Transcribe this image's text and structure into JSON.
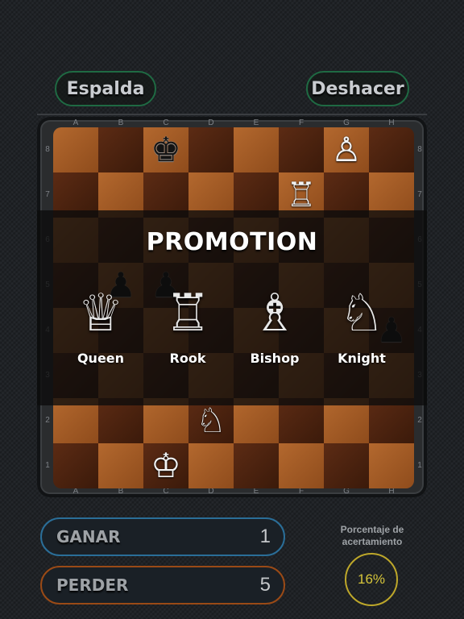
{
  "buttons": {
    "back": "Espalda",
    "undo": "Deshacer"
  },
  "board": {
    "files": [
      "A",
      "B",
      "C",
      "D",
      "E",
      "F",
      "G",
      "H"
    ],
    "ranks": [
      "8",
      "7",
      "6",
      "5",
      "4",
      "3",
      "2",
      "1"
    ],
    "pieces": [
      {
        "square": "c8",
        "piece": "king",
        "color": "black",
        "glyph": "♚"
      },
      {
        "square": "g8",
        "piece": "pawn",
        "color": "white",
        "glyph": "♙"
      },
      {
        "square": "f7",
        "piece": "rook",
        "color": "white",
        "glyph": "♖"
      },
      {
        "square": "b5",
        "piece": "pawn",
        "color": "black",
        "glyph": "♟"
      },
      {
        "square": "c5",
        "piece": "pawn",
        "color": "black",
        "glyph": "♟"
      },
      {
        "square": "h4",
        "piece": "pawn",
        "color": "black",
        "glyph": "♟"
      },
      {
        "square": "d2",
        "piece": "knight",
        "color": "white",
        "glyph": "♘"
      },
      {
        "square": "c1",
        "piece": "king",
        "color": "white",
        "glyph": "♔"
      }
    ]
  },
  "promotion": {
    "title": "PROMOTION",
    "options": [
      {
        "label": "Queen",
        "icon": "queen-icon",
        "glyph": "♕"
      },
      {
        "label": "Rook",
        "icon": "rook-icon",
        "glyph": "♖"
      },
      {
        "label": "Bishop",
        "icon": "bishop-icon",
        "glyph": "♗"
      },
      {
        "label": "Knight",
        "icon": "knight-icon",
        "glyph": "♘"
      }
    ]
  },
  "stats": {
    "win": {
      "label": "GANAR",
      "value": "1"
    },
    "lose": {
      "label": "PERDER",
      "value": "5"
    },
    "accuracy_label": "Porcentaje de acertamiento",
    "accuracy_value": "16%"
  },
  "colors": {
    "win_border": "#2a6e98",
    "lose_border": "#9a4a16",
    "accent_ring": "#bda72a",
    "button_border": "#1f6a43"
  }
}
